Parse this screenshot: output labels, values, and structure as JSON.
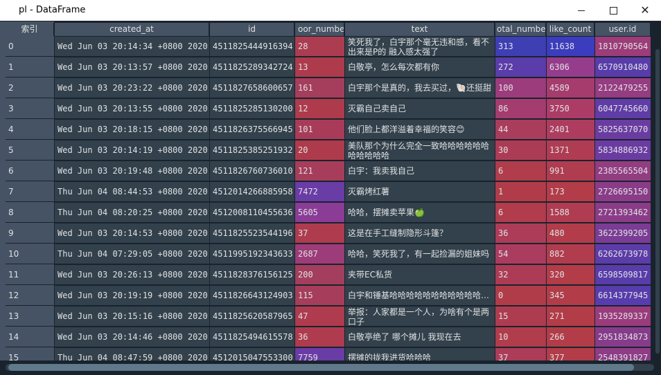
{
  "window": {
    "title": "pl - DataFrame"
  },
  "columns": [
    "索引",
    "created_at",
    "id",
    "oor_numbe",
    "text",
    "otal_numbe",
    "like_count",
    "user.id"
  ],
  "colors": {
    "index_bg": "#455364",
    "cell_bg": "#32414b",
    "window_bg": "#19232d",
    "scroll_thumb": "#60798b"
  },
  "rows": [
    {
      "index": "0",
      "created_at": "Wed Jun 03 20:14:34 +0800 2020",
      "id": "4511825444916394",
      "floor": "28",
      "text": "笑死我了，白宇那个毫无违和感，看不出来是P的 融入感太强了",
      "total": "313",
      "like": "11638",
      "uid": "1810790564",
      "floor_color": "#ac3c50",
      "total_color": "#3f3fb4",
      "like_color": "#3c3cbe",
      "uid_color": "#9c3c78"
    },
    {
      "index": "1",
      "created_at": "Wed Jun 03 20:13:57 +0800 2020",
      "id": "4511825289342724",
      "floor": "13",
      "text": "白敬亭，怎么每次都有你",
      "total": "272",
      "like": "6306",
      "uid": "6570910480",
      "floor_color": "#ae3b4c",
      "total_color": "#5a3caa",
      "like_color": "#963c8c",
      "uid_color": "#583caa"
    },
    {
      "index": "2",
      "created_at": "Wed Jun 03 20:23:22 +0800 2020",
      "id": "4511827658600657",
      "floor": "161",
      "text": "白宇那个是真的，我去买过，🐚还挺甜",
      "total": "100",
      "like": "4589",
      "uid": "2122479255",
      "floor_color": "#a43e5c",
      "total_color": "#9c3c7c",
      "like_color": "#a63c6e",
      "uid_color": "#963c80"
    },
    {
      "index": "3",
      "created_at": "Wed Jun 03 20:13:55 +0800 2020",
      "id": "4511825285130200",
      "floor": "12",
      "text": "灭霸自己卖自己",
      "total": "86",
      "like": "3750",
      "uid": "6047745660",
      "floor_color": "#ae3b4c",
      "total_color": "#a43c70",
      "like_color": "#ac3c66",
      "uid_color": "#603ca6"
    },
    {
      "index": "4",
      "created_at": "Wed Jun 03 20:18:15 +0800 2020",
      "id": "4511826375566945",
      "floor": "101",
      "text": "他们脸上都洋溢着幸福的笑容😊",
      "total": "44",
      "like": "2401",
      "uid": "5825637070",
      "floor_color": "#a83c58",
      "total_color": "#aa3c5c",
      "like_color": "#ae3c5e",
      "uid_color": "#6a3ca2"
    },
    {
      "index": "5",
      "created_at": "Wed Jun 03 20:14:19 +0800 2020",
      "id": "4511825385251932",
      "floor": "20",
      "text": "美队那个为什么完全一致哈哈哈哈哈哈哈哈哈哈哈",
      "total": "30",
      "like": "1371",
      "uid": "5834886932",
      "floor_color": "#ae3b4c",
      "total_color": "#ac3c56",
      "like_color": "#b03c54",
      "uid_color": "#6a3ca2"
    },
    {
      "index": "6",
      "created_at": "Wed Jun 03 20:19:48 +0800 2020",
      "id": "4511826760736010",
      "floor": "121",
      "text": "白宇：我卖我自己",
      "total": "6",
      "like": "991",
      "uid": "2385565504",
      "floor_color": "#a63d5a",
      "total_color": "#b03c4c",
      "like_color": "#b03c50",
      "uid_color": "#923c82"
    },
    {
      "index": "7",
      "created_at": "Thu Jun 04 08:44:53 +0800 2020",
      "id": "4512014266885958",
      "floor": "7472",
      "text": "灭霸烤红薯",
      "total": "1",
      "like": "173",
      "uid": "2726695150",
      "floor_color": "#6a3ca6",
      "total_color": "#b03c4a",
      "like_color": "#b23c48",
      "uid_color": "#8a3c88"
    },
    {
      "index": "8",
      "created_at": "Thu Jun 04 08:20:25 +0800 2020",
      "id": "4512008110455636",
      "floor": "5605",
      "text": "哈哈，摆摊卖苹果🍏",
      "total": "6",
      "like": "1588",
      "uid": "2721393462",
      "floor_color": "#8a3c96",
      "total_color": "#b03c4c",
      "like_color": "#b03c52",
      "uid_color": "#8a3c88"
    },
    {
      "index": "9",
      "created_at": "Wed Jun 03 20:14:53 +0800 2020",
      "id": "4511825523544196",
      "floor": "37",
      "text": "这是在手工缝制隐形斗篷？",
      "total": "36",
      "like": "480",
      "uid": "3622399205",
      "floor_color": "#ae3b4e",
      "total_color": "#ac3c58",
      "like_color": "#b23c4a",
      "uid_color": "#7a3c94"
    },
    {
      "index": "10",
      "created_at": "Thu Jun 04 07:29:05 +0800 2020",
      "id": "4511995192343633",
      "floor": "2687",
      "text": "哈哈，笑死我了，有一起捡漏的姐妹吗",
      "total": "54",
      "like": "882",
      "uid": "6262673978",
      "floor_color": "#9c3c78",
      "total_color": "#aa3c60",
      "like_color": "#b03c4e",
      "uid_color": "#5c3ca8"
    },
    {
      "index": "11",
      "created_at": "Wed Jun 03 20:26:13 +0800 2020",
      "id": "4511828376156125",
      "floor": "200",
      "text": "夹带EC私货",
      "total": "32",
      "like": "320",
      "uid": "6598509817",
      "floor_color": "#a43e5e",
      "total_color": "#ac3c56",
      "like_color": "#b23c48",
      "uid_color": "#583caa"
    },
    {
      "index": "12",
      "created_at": "Wed Jun 03 20:19:19 +0800 2020",
      "id": "4511826643124903",
      "floor": "115",
      "text": "白宇和锤基哈哈哈哈哈哈哈哈哈哈哈…",
      "total": "0",
      "like": "345",
      "uid": "6614377945",
      "floor_color": "#a63d5a",
      "total_color": "#b03c4a",
      "like_color": "#b23c48",
      "uid_color": "#563cac"
    },
    {
      "index": "13",
      "created_at": "Wed Jun 03 20:15:16 +0800 2020",
      "id": "4511825620587965",
      "floor": "47",
      "text": "举报：人家都是一个人，为啥有个是两口子",
      "total": "15",
      "like": "271",
      "uid": "1935289337",
      "floor_color": "#ae3b4e",
      "total_color": "#ae3c50",
      "like_color": "#b23c48",
      "uid_color": "#9a3c7c"
    },
    {
      "index": "14",
      "created_at": "Wed Jun 03 20:14:46 +0800 2020",
      "id": "4511825494615578",
      "floor": "36",
      "text": "白敬亭绝了 哪个摊儿 我现在去",
      "total": "10",
      "like": "266",
      "uid": "2951834873",
      "floor_color": "#ae3b4e",
      "total_color": "#b03c4c",
      "like_color": "#b23c48",
      "uid_color": "#863c8a"
    },
    {
      "index": "15",
      "created_at": "Thu Jun 04 08:47:59 +0800 2020",
      "id": "4512015047553300",
      "floor": "7759",
      "text": "摆摊的拢我进货哈哈哈",
      "total": "37",
      "like": "377",
      "uid": "2548391827",
      "floor_color": "#6a3ca6",
      "total_color": "#ac3c58",
      "like_color": "#b23c48",
      "uid_color": "#8e3c86"
    }
  ]
}
